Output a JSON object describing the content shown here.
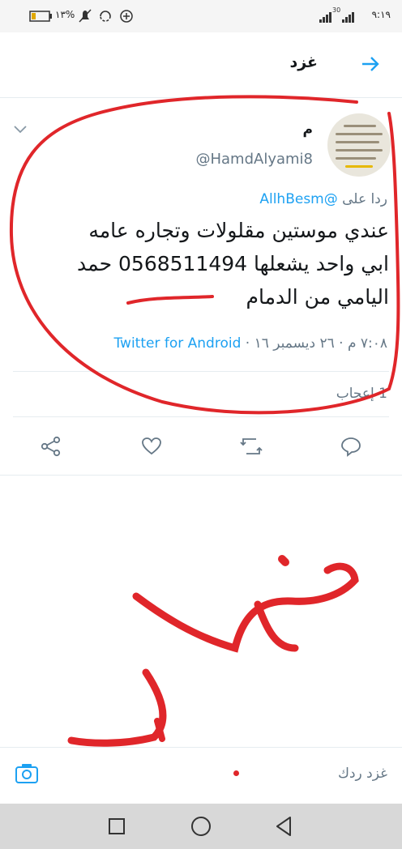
{
  "status_bar": {
    "time": "٩:١٩",
    "battery_percent": "١٣%",
    "signal_label": "30"
  },
  "header": {
    "title": "غزد",
    "back_icon": "arrow-right-icon"
  },
  "tweet": {
    "display_name": "م",
    "handle": "@HamdAlyami8",
    "replying_prefix": "ردا على",
    "replying_to": "@AllhBesm",
    "text_lines": [
      "عندي موستين مقلولات وتجاره عامه",
      "ابي واحد يشعلها 0568511494 حمد",
      "اليامي من الدمام"
    ],
    "timestamp": "٧:٠٨ م · ٢٦ ديسمبر ١٦ ·",
    "source": "Twitter for Android",
    "likes_label": "1 إعجاب"
  },
  "actions": [
    "share-icon",
    "like-icon",
    "retweet-icon",
    "reply-icon"
  ],
  "composer": {
    "placeholder": "غزد ردك"
  },
  "annotation_text": "نصاب",
  "colors": {
    "twitter_blue": "#1da1f2",
    "annotation_red": "#e0262a",
    "muted": "#657786"
  }
}
